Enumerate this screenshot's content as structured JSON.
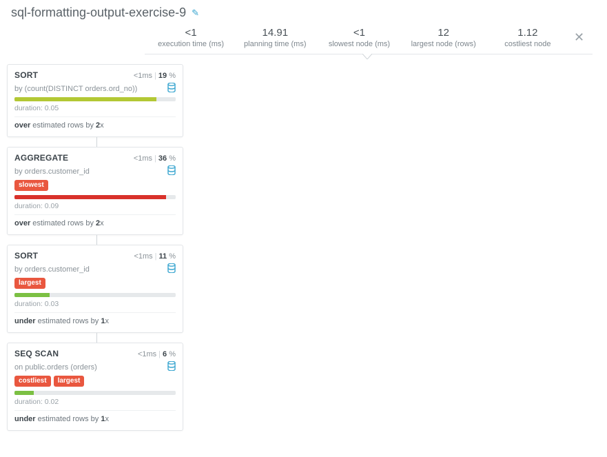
{
  "title": "sql-formatting-output-exercise-9",
  "icons": {
    "pencil": "✎",
    "close": "✕"
  },
  "stats": [
    {
      "value": "<1",
      "label": "execution time (ms)"
    },
    {
      "value": "14.91",
      "label": "planning time (ms)"
    },
    {
      "value": "<1",
      "label": "slowest node (ms)"
    },
    {
      "value": "12",
      "label": "largest node (rows)"
    },
    {
      "value": "1.12",
      "label": "costliest node"
    }
  ],
  "labels": {
    "duration_prefix": "duration: ",
    "est_over_a": "over",
    "est_over_b": " estimated rows by ",
    "est_under_a": "under",
    "est_under_b": " estimated rows by "
  },
  "colors": {
    "olive": "#b3c834",
    "red": "#d9322b",
    "green": "#7bc043"
  },
  "nodes": [
    {
      "title": "SORT",
      "time": "<1ms",
      "pct": "19",
      "sub_prefix": "by ",
      "sub_value": "(count(DISTINCT orders.ord_no))",
      "tags": [],
      "bar_pct": 88,
      "bar_color": "olive",
      "duration": "0.05",
      "est_dir": "over",
      "est_factor": "2"
    },
    {
      "title": "AGGREGATE",
      "time": "<1ms",
      "pct": "36",
      "sub_prefix": "by ",
      "sub_value": "orders.customer_id",
      "tags": [
        "slowest"
      ],
      "bar_pct": 94,
      "bar_color": "red",
      "duration": "0.09",
      "est_dir": "over",
      "est_factor": "2"
    },
    {
      "title": "SORT",
      "time": "<1ms",
      "pct": "11",
      "sub_prefix": "by ",
      "sub_value": "orders.customer_id",
      "tags": [
        "largest"
      ],
      "bar_pct": 22,
      "bar_color": "green",
      "duration": "0.03",
      "est_dir": "under",
      "est_factor": "1"
    },
    {
      "title": "SEQ SCAN",
      "time": "<1ms",
      "pct": "6",
      "sub_prefix": "on ",
      "sub_value": "public.orders (orders)",
      "tags": [
        "costliest",
        "largest"
      ],
      "bar_pct": 12,
      "bar_color": "green",
      "duration": "0.02",
      "est_dir": "under",
      "est_factor": "1"
    }
  ]
}
